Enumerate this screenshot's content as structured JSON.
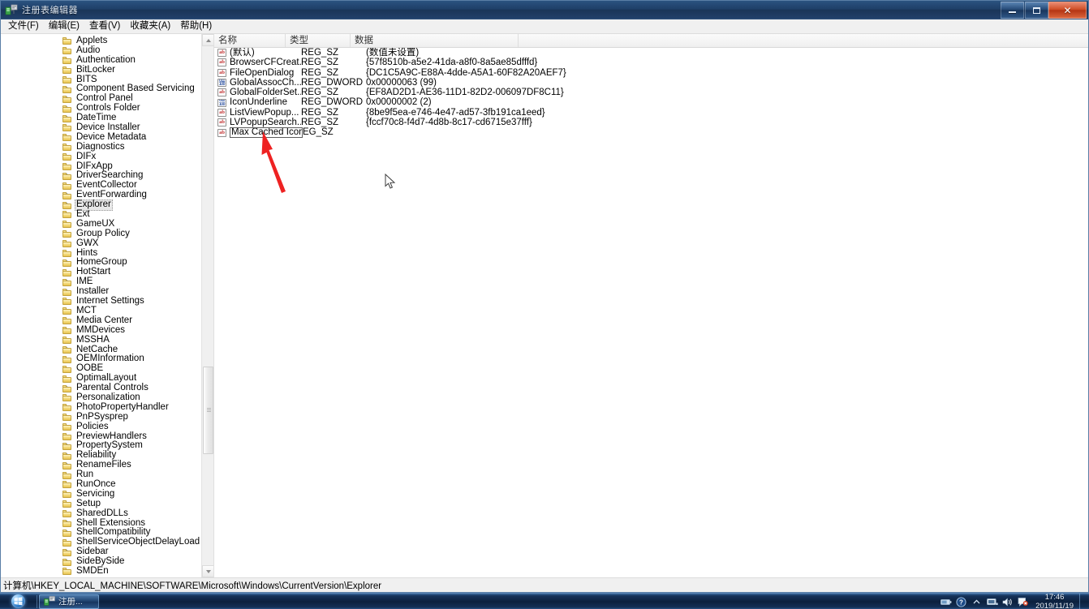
{
  "window": {
    "title": "注册表编辑器",
    "icon": "registry-editor-icon",
    "buttons": {
      "minimize": "–",
      "maximize": "□",
      "close": "✕"
    }
  },
  "menu": {
    "items": [
      {
        "label": "文件(F)",
        "name": "menu-file"
      },
      {
        "label": "编辑(E)",
        "name": "menu-edit"
      },
      {
        "label": "查看(V)",
        "name": "menu-view"
      },
      {
        "label": "收藏夹(A)",
        "name": "menu-favorites"
      },
      {
        "label": "帮助(H)",
        "name": "menu-help"
      }
    ]
  },
  "tree": {
    "selected": "Explorer",
    "items": [
      {
        "label": "Applets",
        "expandable": true
      },
      {
        "label": "Audio",
        "expandable": false
      },
      {
        "label": "Authentication",
        "expandable": true
      },
      {
        "label": "BitLocker",
        "expandable": false
      },
      {
        "label": "BITS",
        "expandable": false
      },
      {
        "label": "Component Based Servicing",
        "expandable": true
      },
      {
        "label": "Control Panel",
        "expandable": true
      },
      {
        "label": "Controls Folder",
        "expandable": true
      },
      {
        "label": "DateTime",
        "expandable": true
      },
      {
        "label": "Device Installer",
        "expandable": false
      },
      {
        "label": "Device Metadata",
        "expandable": false
      },
      {
        "label": "Diagnostics",
        "expandable": true
      },
      {
        "label": "DIFx",
        "expandable": true
      },
      {
        "label": "DIFxApp",
        "expandable": true
      },
      {
        "label": "DriverSearching",
        "expandable": true
      },
      {
        "label": "EventCollector",
        "expandable": false
      },
      {
        "label": "EventForwarding",
        "expandable": true
      },
      {
        "label": "Explorer",
        "expandable": true
      },
      {
        "label": "Ext",
        "expandable": true
      },
      {
        "label": "GameUX",
        "expandable": true
      },
      {
        "label": "Group Policy",
        "expandable": true
      },
      {
        "label": "GWX",
        "expandable": true
      },
      {
        "label": "Hints",
        "expandable": false
      },
      {
        "label": "HomeGroup",
        "expandable": true
      },
      {
        "label": "HotStart",
        "expandable": false
      },
      {
        "label": "IME",
        "expandable": true
      },
      {
        "label": "Installer",
        "expandable": true
      },
      {
        "label": "Internet Settings",
        "expandable": true
      },
      {
        "label": "MCT",
        "expandable": true
      },
      {
        "label": "Media Center",
        "expandable": true
      },
      {
        "label": "MMDevices",
        "expandable": true
      },
      {
        "label": "MSSHA",
        "expandable": false
      },
      {
        "label": "NetCache",
        "expandable": true
      },
      {
        "label": "OEMInformation",
        "expandable": false
      },
      {
        "label": "OOBE",
        "expandable": false
      },
      {
        "label": "OptimalLayout",
        "expandable": false
      },
      {
        "label": "Parental Controls",
        "expandable": true
      },
      {
        "label": "Personalization",
        "expandable": false
      },
      {
        "label": "PhotoPropertyHandler",
        "expandable": true
      },
      {
        "label": "PnPSysprep",
        "expandable": true
      },
      {
        "label": "Policies",
        "expandable": true
      },
      {
        "label": "PreviewHandlers",
        "expandable": false
      },
      {
        "label": "PropertySystem",
        "expandable": true
      },
      {
        "label": "Reliability",
        "expandable": true
      },
      {
        "label": "RenameFiles",
        "expandable": true
      },
      {
        "label": "Run",
        "expandable": false
      },
      {
        "label": "RunOnce",
        "expandable": false
      },
      {
        "label": "Servicing",
        "expandable": true
      },
      {
        "label": "Setup",
        "expandable": true
      },
      {
        "label": "SharedDLLs",
        "expandable": false
      },
      {
        "label": "Shell Extensions",
        "expandable": true
      },
      {
        "label": "ShellCompatibility",
        "expandable": true
      },
      {
        "label": "ShellServiceObjectDelayLoad",
        "expandable": false
      },
      {
        "label": "Sidebar",
        "expandable": true
      },
      {
        "label": "SideBySide",
        "expandable": true
      },
      {
        "label": "SMDEn",
        "expandable": false
      }
    ]
  },
  "values": {
    "columns": [
      {
        "label": "名称",
        "name": "column-name"
      },
      {
        "label": "类型",
        "name": "column-type"
      },
      {
        "label": "数据",
        "name": "column-data"
      }
    ],
    "rows": [
      {
        "name": "(默认)",
        "type": "REG_SZ",
        "data": "(数值未设置)",
        "icon": "string-value-icon"
      },
      {
        "name": "BrowserCFCreat...",
        "type": "REG_SZ",
        "data": "{57f8510b-a5e2-41da-a8f0-8a5ae85dfffd}",
        "icon": "string-value-icon"
      },
      {
        "name": "FileOpenDialog",
        "type": "REG_SZ",
        "data": "{DC1C5A9C-E88A-4dde-A5A1-60F82A20AEF7}",
        "icon": "string-value-icon"
      },
      {
        "name": "GlobalAssocCh...",
        "type": "REG_DWORD",
        "data": "0x00000063 (99)",
        "icon": "dword-value-icon"
      },
      {
        "name": "GlobalFolderSet...",
        "type": "REG_SZ",
        "data": "{EF8AD2D1-AE36-11D1-82D2-006097DF8C11}",
        "icon": "string-value-icon"
      },
      {
        "name": "IconUnderline",
        "type": "REG_DWORD",
        "data": "0x00000002 (2)",
        "icon": "dword-value-icon"
      },
      {
        "name": "ListViewPopup...",
        "type": "REG_SZ",
        "data": "{8be9f5ea-e746-4e47-ad57-3fb191ca1eed}",
        "icon": "string-value-icon"
      },
      {
        "name": "LVPopupSearch...",
        "type": "REG_SZ",
        "data": "{fccf70c8-f4d7-4d8b-8c17-cd6715e37fff}",
        "icon": "string-value-icon"
      },
      {
        "name": "Max Cached Icons",
        "type": "EG_SZ",
        "data": "",
        "icon": "string-value-icon",
        "editing": true
      }
    ],
    "editing_value": "Max Cached Icons"
  },
  "status": {
    "path": "计算机\\HKEY_LOCAL_MACHINE\\SOFTWARE\\Microsoft\\Windows\\CurrentVersion\\Explorer"
  },
  "annotation": {
    "arrow_color": "#ee2222",
    "points_to": "Max Cached Icons"
  },
  "taskbar": {
    "start_label": "start-orb",
    "task_button": {
      "label": "注册...",
      "icon": "registry-editor-icon"
    },
    "tray": [
      {
        "name": "tray-battery-icon"
      },
      {
        "name": "tray-help-icon"
      },
      {
        "name": "tray-chevron-up-icon"
      },
      {
        "name": "tray-network-icon"
      },
      {
        "name": "tray-volume-icon"
      },
      {
        "name": "tray-action-center-icon"
      }
    ],
    "clock": {
      "time": "17:46",
      "date": "2019/11/19"
    }
  }
}
